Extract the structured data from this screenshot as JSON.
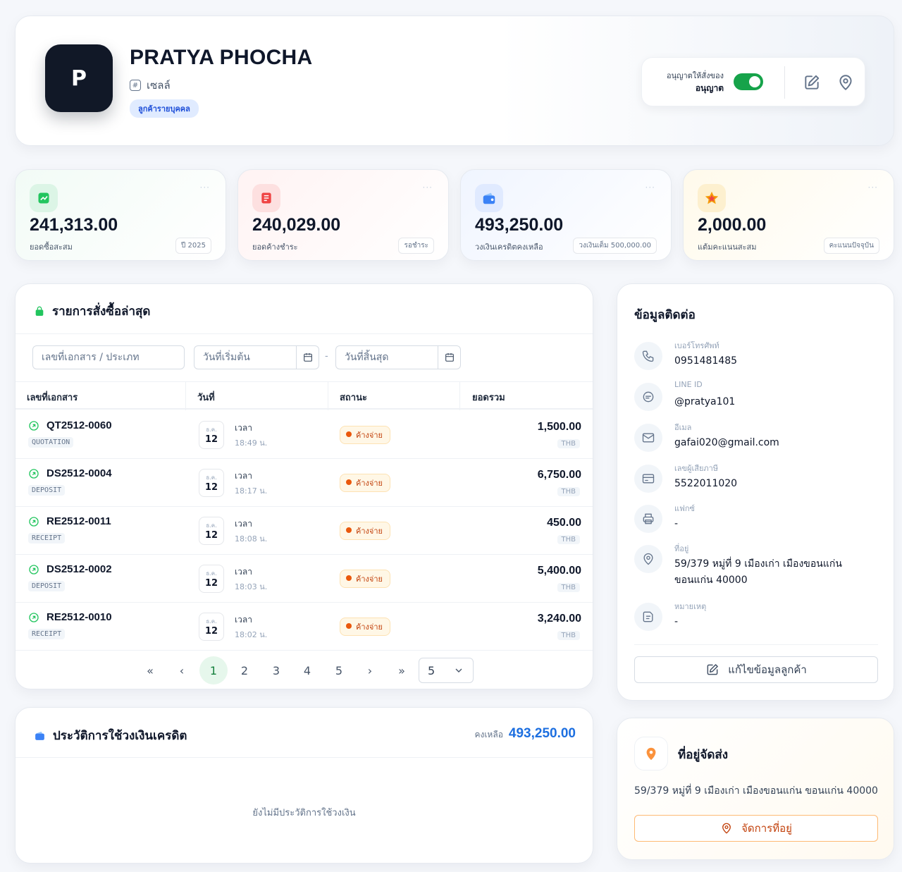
{
  "customer": {
    "initial": "P",
    "name": "PRATYA PHOCHA",
    "group": "เซลล์",
    "type": "ลูกค้ารายบุคคล",
    "permission_label": "อนุญาตให้สั่งของ",
    "permission_value": "อนุญาต",
    "permission_on": true
  },
  "stats": [
    {
      "value": "241,313.00",
      "label": "ยอดซื้อสะสม",
      "tag": "ปี 2025",
      "icon": "trending-up-icon",
      "color": "#22c55e"
    },
    {
      "value": "240,029.00",
      "label": "ยอดค้างชำระ",
      "tag": "รอชำระ",
      "icon": "invoice-icon",
      "color": "#ef4444"
    },
    {
      "value": "493,250.00",
      "label": "วงเงินเครดิตคงเหลือ",
      "tag": "วงเงินเต็ม 500,000.00",
      "icon": "wallet-icon",
      "color": "#3b82f6"
    },
    {
      "value": "2,000.00",
      "label": "แต้มคะแนนสะสม",
      "tag": "คะแนนปัจจุบัน",
      "icon": "star-icon",
      "color": "#f59e0b"
    }
  ],
  "orders": {
    "title": "รายการสั่งซื้อล่าสุด",
    "search_placeholder": "เลขที่เอกสาร / ประเภท",
    "start_placeholder": "วันที่เริ่มต้น",
    "end_placeholder": "วันที่สิ้นสุด",
    "date_sep": "-",
    "columns": [
      "เลขที่เอกสาร",
      "วันที่",
      "สถานะ",
      "ยอดรวม"
    ],
    "time_label": "เวลา",
    "rows": [
      {
        "doc": "QT2512-0060",
        "type": "QUOTATION",
        "month": "ธ.ค.",
        "day": "12",
        "time": "18:49 น.",
        "status": "ค้างจ่าย",
        "amount": "1,500.00",
        "currency": "THB"
      },
      {
        "doc": "DS2512-0004",
        "type": "DEPOSIT",
        "month": "ธ.ค.",
        "day": "12",
        "time": "18:17 น.",
        "status": "ค้างจ่าย",
        "amount": "6,750.00",
        "currency": "THB"
      },
      {
        "doc": "RE2512-0011",
        "type": "RECEIPT",
        "month": "ธ.ค.",
        "day": "12",
        "time": "18:08 น.",
        "status": "ค้างจ่าย",
        "amount": "450.00",
        "currency": "THB"
      },
      {
        "doc": "DS2512-0002",
        "type": "DEPOSIT",
        "month": "ธ.ค.",
        "day": "12",
        "time": "18:03 น.",
        "status": "ค้างจ่าย",
        "amount": "5,400.00",
        "currency": "THB"
      },
      {
        "doc": "RE2512-0010",
        "type": "RECEIPT",
        "month": "ธ.ค.",
        "day": "12",
        "time": "18:02 น.",
        "status": "ค้างจ่าย",
        "amount": "3,240.00",
        "currency": "THB"
      }
    ],
    "pagination": {
      "first": "«",
      "prev": "‹",
      "pages": [
        "1",
        "2",
        "3",
        "4",
        "5"
      ],
      "next": "›",
      "last": "»",
      "active": "1",
      "page_size": "5"
    }
  },
  "credit": {
    "title": "ประวัติการใช้วงเงินเครดิต",
    "remaining_label": "คงเหลือ",
    "remaining_value": "493,250.00",
    "empty_message": "ยังไม่มีประวัติการใช้วงเงิน"
  },
  "contact": {
    "title": "ข้อมูลติดต่อ",
    "items": [
      {
        "label": "เบอร์โทรศัพท์",
        "value": "0951481485",
        "icon": "phone-icon"
      },
      {
        "label": "LINE ID",
        "value": "@pratya101",
        "icon": "chat-icon"
      },
      {
        "label": "อีเมล",
        "value": "gafai020@gmail.com",
        "icon": "mail-icon"
      },
      {
        "label": "เลขผู้เสียภาษี",
        "value": "5522011020",
        "icon": "card-icon"
      },
      {
        "label": "แฟกซ์",
        "value": "-",
        "icon": "printer-icon"
      },
      {
        "label": "ที่อยู่",
        "value": "59/379 หมู่ที่ 9 เมืองเก่า เมืองขอนแก่น ขอนแก่น 40000",
        "icon": "location-icon"
      },
      {
        "label": "หมายเหตุ",
        "value": "-",
        "icon": "note-icon"
      }
    ],
    "edit_button": "แก้ไขข้อมูลลูกค้า"
  },
  "shipping": {
    "title": "ที่อยู่จัดส่ง",
    "address": "59/379 หมู่ที่ 9 เมืองเก่า เมืองขอนแก่น ขอนแก่น 40000",
    "manage_button": "จัดการที่อยู่"
  }
}
